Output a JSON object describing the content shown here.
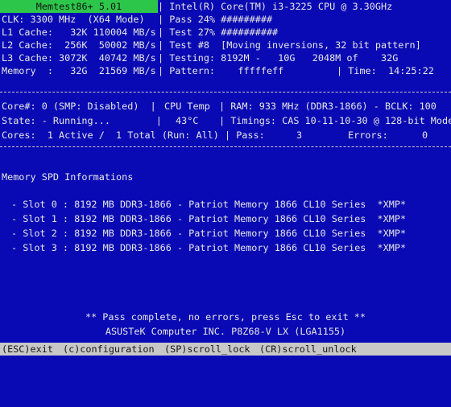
{
  "header": {
    "title": "Memtest86+ 5.01",
    "cpu": "| Intel(R) Core(TM) i3-3225 CPU @ 3.30GHz",
    "clk": "CLK: 3300 MHz  (X64 Mode)",
    "pass_pct": "| Pass 24% #########",
    "l1": "L1 Cache:   32K 110004 MB/s",
    "test_pct": "| Test 27% ##########",
    "l2": "L2 Cache:  256K  50002 MB/s",
    "test_num": "| Test #8  [Moving inversions, 32 bit pattern]",
    "l3": "L3 Cache: 3072K  40742 MB/s",
    "testing": "| Testing: 8192M -   10G   2048M of    32G",
    "memory": "Memory  :   32G  21569 MB/s",
    "pattern": "| Pattern:    fffffeff",
    "time_label": "| Time:",
    "time_value": "14:25:22"
  },
  "status": {
    "core": "Core#: 0 (SMP: Disabled)  |",
    "cpu_temp_label": "CPU Temp",
    "ram": "| RAM: 933 MHz (DDR3-1866) - BCLK: 100",
    "state": "State: - Running...        |",
    "cpu_temp_value": "43°C",
    "timings": "| Timings: CAS 10-11-10-30 @ 128-bit Mode",
    "cores": "Cores:  1 Active /  1 Total (Run: All) | Pass:",
    "pass_value": "3",
    "errors_label": "Errors:",
    "errors_value": "0"
  },
  "spd": {
    "heading": "Memory SPD Informations",
    "slots": [
      "- Slot 0 : 8192 MB DDR3-1866 - Patriot Memory 1866 CL10 Series  *XMP*",
      "- Slot 1 : 8192 MB DDR3-1866 - Patriot Memory 1866 CL10 Series  *XMP*",
      "- Slot 2 : 8192 MB DDR3-1866 - Patriot Memory 1866 CL10 Series  *XMP*",
      "- Slot 3 : 8192 MB DDR3-1866 - Patriot Memory 1866 CL10 Series  *XMP*"
    ]
  },
  "footer": {
    "message": "** Pass complete, no errors, press Esc to exit **",
    "board": "ASUSTeK Computer INC. P8Z68-V LX (LGA1155)"
  },
  "bottom_bar": {
    "esc": "(ESC)exit",
    "config": "(c)configuration",
    "scroll_lock": "(SP)scroll_lock",
    "scroll_unlock": "(CR)scroll_unlock"
  },
  "colors": {
    "background": "#0a0ab4",
    "title_bg": "#2cc74a",
    "text": "#e6e6e6",
    "bar_bg": "#c8c8c8"
  }
}
